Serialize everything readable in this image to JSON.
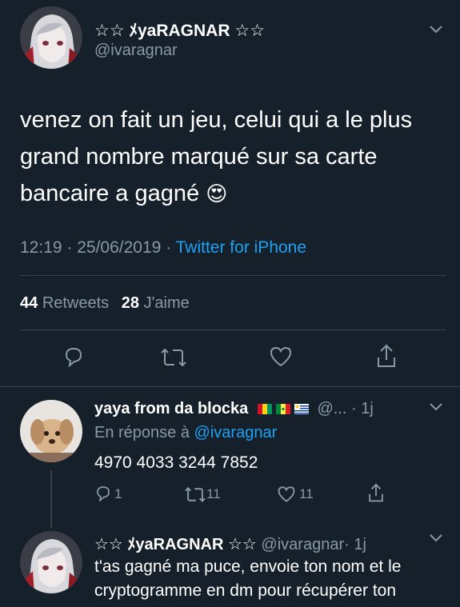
{
  "tweet": {
    "display_name": "☆☆ ﾒyaRAGNAR ☆☆",
    "handle": "@ivaragnar",
    "text_lines": [
      "venez on fait un jeu, celui qui a le plus",
      "grand nombre marqué sur sa carte",
      "bancaire a gagné"
    ],
    "emoji": "😍",
    "timestamp": "12:19 · 25/06/2019 ·",
    "source": "Twitter for iPhone",
    "retweets_count": "44",
    "retweets_label": "Retweets",
    "likes_count": "28",
    "likes_label": "J'aime"
  },
  "reply1": {
    "display_name": "yaya from da blocka",
    "flags": [
      "guinea-flag",
      "senegal-flag",
      "uruguay-flag"
    ],
    "handle_truncated": "@...",
    "time": "· 1j",
    "reply_prefix": "En réponse à",
    "reply_to": "@ivaragnar",
    "text": "4970 4033 3244 7852",
    "reply_count": "1",
    "retweet_count": "11",
    "like_count": "11"
  },
  "reply2": {
    "display_name": "☆☆ ﾒyaRAGNAR ☆☆",
    "handle": "@ivaragnar",
    "time": "· 1j",
    "text_lines": [
      "t'as gagné ma puce, envoie ton nom et le",
      "cryptogramme en dm pour récupérer ton"
    ]
  },
  "colors": {
    "background": "#15202b",
    "text": "#ffffff",
    "muted": "#8899a6",
    "link": "#1da1f2",
    "divider": "#38444d"
  }
}
